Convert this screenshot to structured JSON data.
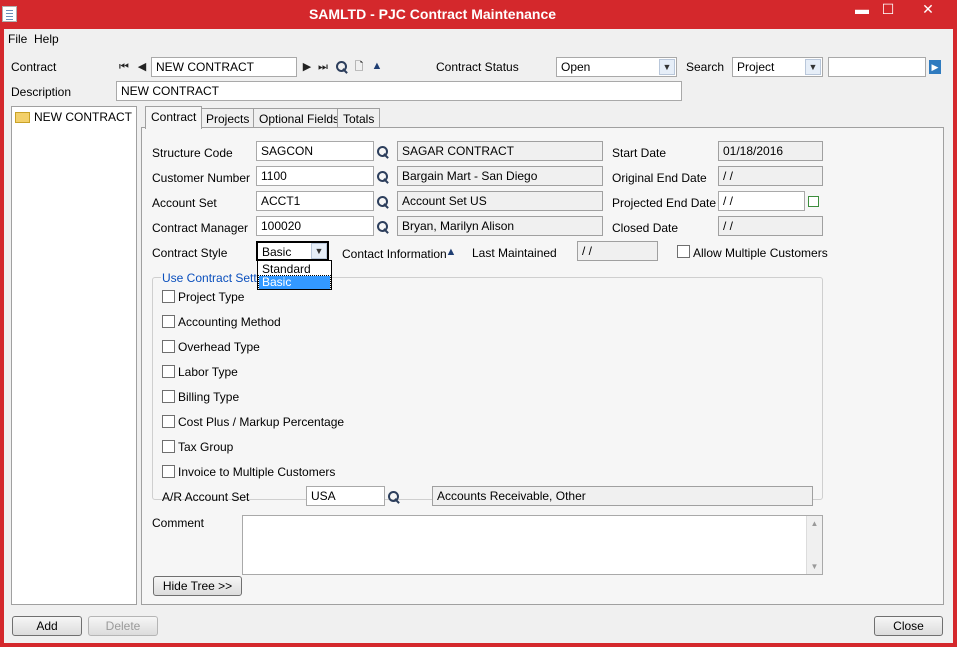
{
  "window": {
    "title": "SAMLTD - PJC Contract Maintenance"
  },
  "menu": {
    "file": "File",
    "help": "Help"
  },
  "contract": {
    "label": "Contract",
    "value": "NEW CONTRACT",
    "status_label": "Contract Status",
    "status_value": "Open",
    "search_label": "Search",
    "search_type": "Project",
    "search_value": ""
  },
  "description": {
    "label": "Description",
    "value": "NEW CONTRACT"
  },
  "tree": {
    "node": "NEW CONTRACT"
  },
  "tabs": [
    {
      "label": "Contract"
    },
    {
      "label": "Projects"
    },
    {
      "label": "Optional Fields"
    },
    {
      "label": "Totals"
    }
  ],
  "form": {
    "structure_code": {
      "label": "Structure Code",
      "value": "SAGCON",
      "desc": "SAGAR CONTRACT"
    },
    "customer_number": {
      "label": "Customer Number",
      "value": "1100",
      "desc": "Bargain Mart - San Diego"
    },
    "account_set": {
      "label": "Account Set",
      "value": "ACCT1",
      "desc": "Account Set US"
    },
    "contract_manager": {
      "label": "Contract Manager",
      "value": "100020",
      "desc": "Bryan, Marilyn Alison"
    },
    "start_date": {
      "label": "Start Date",
      "value": "01/18/2016"
    },
    "original_end_date": {
      "label": "Original End Date",
      "value": " /  /"
    },
    "projected_end_date": {
      "label": "Projected End Date",
      "value": " /  /"
    },
    "closed_date": {
      "label": "Closed Date",
      "value": " /  /"
    },
    "contract_style": {
      "label": "Contract Style",
      "value": "Basic",
      "options": [
        "Standard",
        "Basic"
      ]
    },
    "contact_information": "Contact Information",
    "last_maintained": {
      "label": "Last Maintained",
      "value": " /  /"
    },
    "allow_multiple_customers": "Allow Multiple Customers",
    "use_contract_settings": "Use Contract Settings",
    "settings": [
      "Project Type",
      "Accounting Method",
      "Overhead Type",
      "Labor Type",
      "Billing Type",
      "Cost Plus / Markup Percentage",
      "Tax Group",
      "Invoice to Multiple Customers"
    ],
    "ar_account_set": {
      "label": "A/R Account Set",
      "value": "USA",
      "desc": "Accounts Receivable, Other"
    },
    "comment_label": "Comment",
    "comment_value": ""
  },
  "buttons": {
    "hide_tree": "Hide Tree >>",
    "add": "Add",
    "delete": "Delete",
    "close": "Close"
  }
}
